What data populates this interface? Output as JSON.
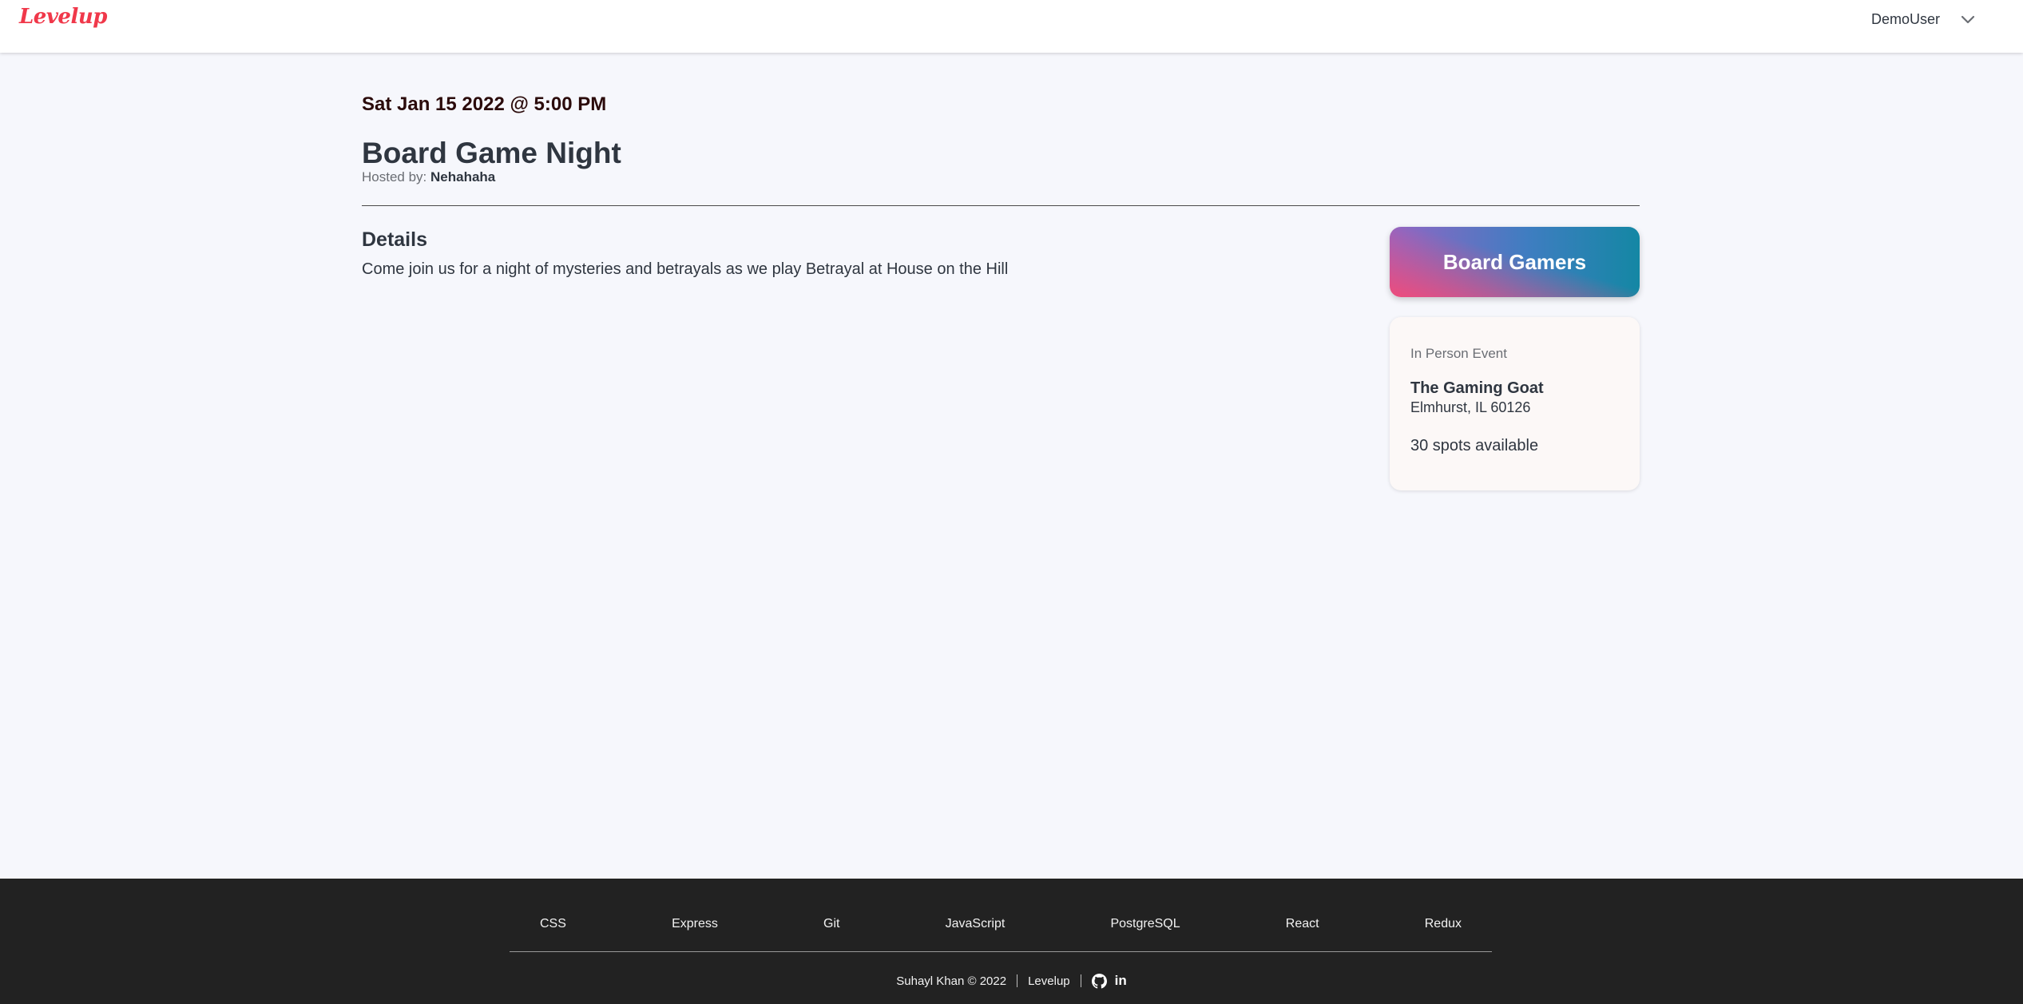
{
  "header": {
    "logo": "Levelup",
    "user_name": "DemoUser",
    "dropdown_icon": "chevron-down-icon"
  },
  "event": {
    "date": "Sat Jan 15 2022 @ 5:00 PM",
    "title": "Board Game Night",
    "hosted_label": "Hosted by: ",
    "host": "Nehahaha",
    "details_heading": "Details",
    "details": "Come join us for a night of mysteries and betrayals as we play Betrayal at House on the Hill"
  },
  "sidebar": {
    "group_name": "Board Gamers",
    "event_type": "In Person Event",
    "venue": "The Gaming Goat",
    "address": "Elmhurst, IL 60126",
    "spots": "30 spots available"
  },
  "footer": {
    "technologies": [
      "CSS",
      "Express",
      "Git",
      "JavaScript",
      "PostgreSQL",
      "React",
      "Redux"
    ],
    "credit": "Suhayl Khan © 2022",
    "app_name": "Levelup",
    "icons": [
      "github-icon",
      "linkedin-icon"
    ],
    "linkedin_text": "in"
  },
  "colors": {
    "brand": "#f0384a",
    "date_text": "#2b0b0b",
    "footer_bg": "#222222",
    "page_bg": "#f6f7fc"
  }
}
